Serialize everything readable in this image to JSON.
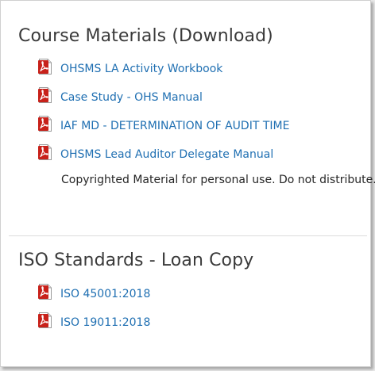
{
  "course_materials": {
    "title": "Course Materials (Download)",
    "files": [
      {
        "label": "OHSMS LA Activity Workbook",
        "icon": "pdf-icon"
      },
      {
        "label": "Case Study - OHS Manual",
        "icon": "pdf-icon"
      },
      {
        "label": "IAF MD - DETERMINATION OF AUDIT TIME",
        "icon": "pdf-icon"
      },
      {
        "label": "OHSMS Lead Auditor Delegate Manual",
        "icon": "pdf-icon"
      }
    ],
    "note": "Copyrighted Material for personal use. Do not distribute."
  },
  "iso_standards": {
    "title": "ISO Standards - Loan Copy",
    "files": [
      {
        "label": "ISO 45001:2018",
        "icon": "pdf-icon"
      },
      {
        "label": "ISO 19011:2018",
        "icon": "pdf-icon"
      }
    ]
  },
  "colors": {
    "link": "#1f6fb2",
    "heading": "#3a3a3a",
    "pdf_red": "#c8211a"
  }
}
